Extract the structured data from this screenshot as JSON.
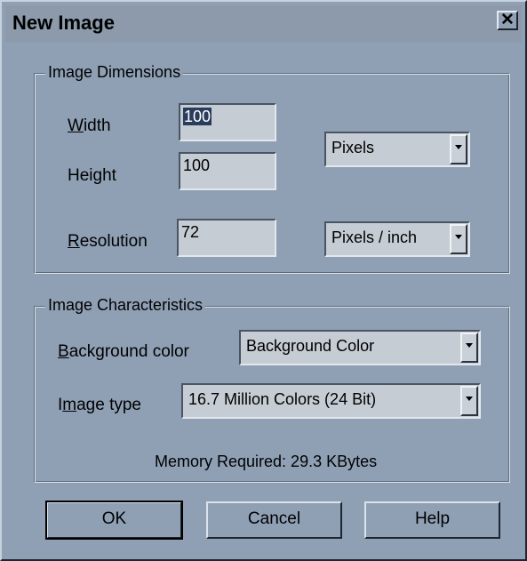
{
  "dialog": {
    "title": "New Image",
    "close_label": "✕"
  },
  "dimensions": {
    "legend": "Image Dimensions",
    "width_label_u": "W",
    "width_label_rest": "idth",
    "width_value": "100",
    "height_label_pre": "Hei",
    "height_label_u": "g",
    "height_label_rest": "ht",
    "height_value": "100",
    "units_value": "Pixels",
    "resolution_label_u": "R",
    "resolution_label_rest": "esolution",
    "resolution_value": "72",
    "resolution_units_value": "Pixels / inch"
  },
  "characteristics": {
    "legend": "Image Characteristics",
    "bg_label_u": "B",
    "bg_label_rest": "ackground color",
    "bg_value": "Background Color",
    "type_label_pre": "I",
    "type_label_u": "m",
    "type_label_rest": "age type",
    "type_value": "16.7 Million Colors (24 Bit)",
    "memory_text": "Memory Required: 29.3 KBytes"
  },
  "buttons": {
    "ok": "OK",
    "cancel": "Cancel",
    "help": "Help"
  }
}
